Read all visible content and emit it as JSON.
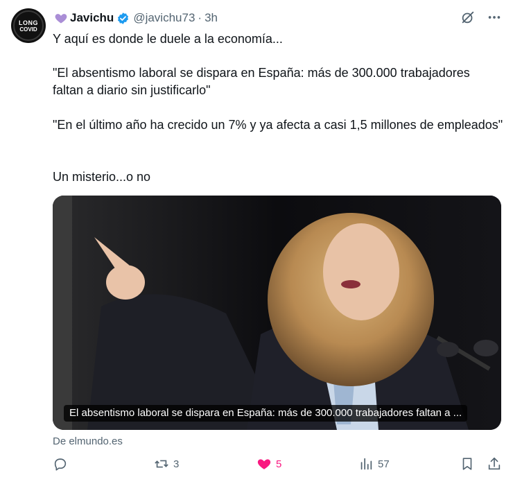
{
  "author": {
    "display_name": "Javichu",
    "handle": "@javichu73",
    "separator": "·",
    "time": "3h",
    "avatar_text_line1": "LONG",
    "avatar_text_line2": "COVID"
  },
  "tweet": {
    "paragraphs": [
      "Y aquí es donde le duele a la economía...",
      "\"El absentismo laboral se dispara en España: más de 300.000 trabajadores faltan a diario sin justificarlo\"",
      "\"En el último año ha crecido un 7% y ya afecta a casi 1,5 millones de empleados\"",
      "Un misterio...o no"
    ]
  },
  "card": {
    "caption": "El absentismo laboral se dispara en España: más de 300.000 trabajadores faltan a ...",
    "source": "De elmundo.es"
  },
  "actions": {
    "replies": "",
    "reposts": "3",
    "likes": "5",
    "views": "57"
  },
  "colors": {
    "like_active": "#f91880",
    "verified": "#1d9bf0",
    "heart_emoji": "#aa8ed6",
    "secondary_text": "#536471"
  },
  "icons": {
    "grok": "grok-icon",
    "more": "more-icon",
    "reply": "reply-icon",
    "repost": "repost-icon",
    "like": "heart-filled-icon",
    "views": "views-icon",
    "bookmark": "bookmark-icon",
    "share": "share-icon"
  }
}
